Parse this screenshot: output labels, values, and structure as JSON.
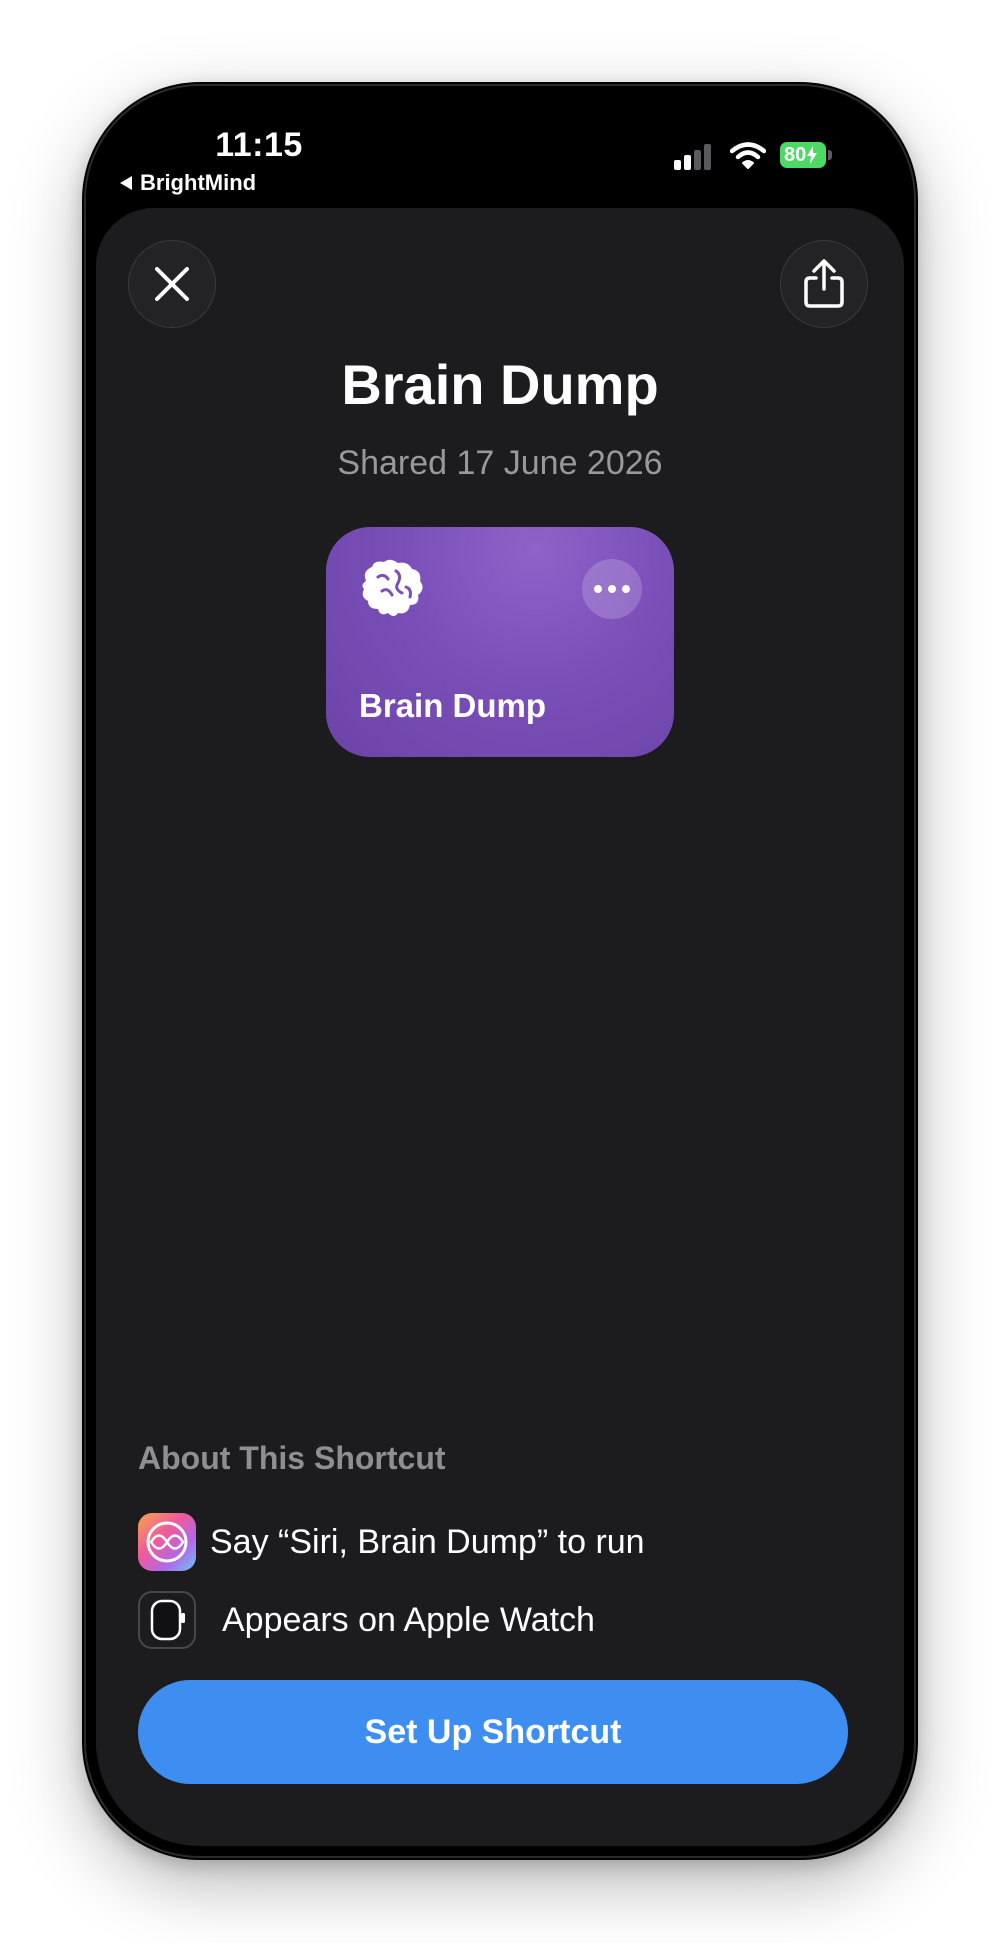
{
  "status_bar": {
    "time": "11:15",
    "back_app": "BrightMind",
    "battery_level": "80",
    "signal_bars_active": 2,
    "signal_bars_total": 4,
    "battery_color": "#4cd964"
  },
  "header": {
    "close_icon": "close-icon",
    "share_icon": "share-icon"
  },
  "shortcut": {
    "title": "Brain Dump",
    "shared_date": "Shared 17 June 2026",
    "card": {
      "label": "Brain Dump",
      "icon": "brain-icon",
      "color": "#7a4fb8"
    }
  },
  "about": {
    "heading": "About This Shortcut",
    "items": [
      {
        "icon": "siri-icon",
        "text": "Say “Siri, Brain Dump” to run"
      },
      {
        "icon": "apple-watch-icon",
        "text": "Appears on Apple Watch"
      }
    ]
  },
  "actions": {
    "setup_label": "Set Up Shortcut",
    "setup_color": "#3e8ef2"
  }
}
